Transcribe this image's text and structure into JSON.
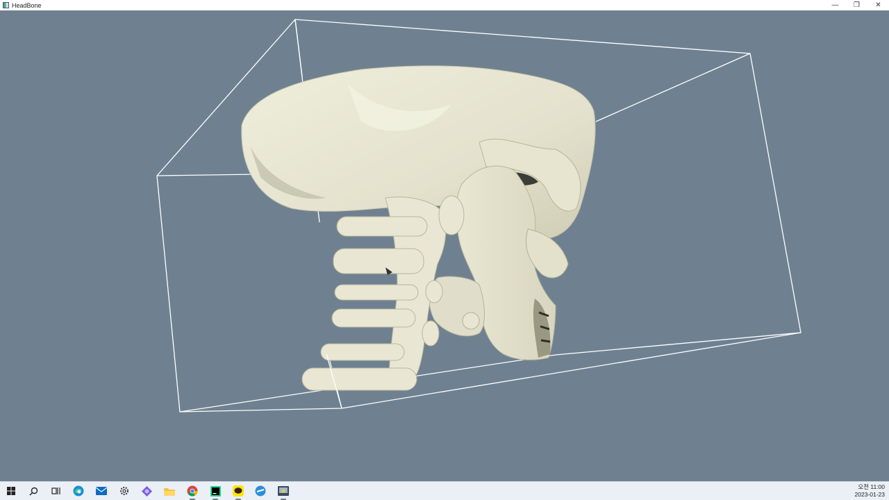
{
  "window": {
    "title": "HeadBone",
    "minimize_glyph": "—",
    "restore_glyph": "❐",
    "close_glyph": "✕"
  },
  "viewport": {
    "background": "#6f8191",
    "model": "skull-and-cervical-spine-bone-surface",
    "bone_color": "#ebe9d6",
    "bounding_box_color": "#ffffff"
  },
  "taskbar": {
    "icons": [
      {
        "name": "windows-start-icon",
        "interactable": true
      },
      {
        "name": "search-icon",
        "interactable": true
      },
      {
        "name": "task-view-icon",
        "interactable": true
      },
      {
        "name": "edge-browser-icon",
        "interactable": true
      },
      {
        "name": "mail-icon",
        "interactable": true
      },
      {
        "name": "settings-gear-icon",
        "interactable": true
      },
      {
        "name": "app-purple-icon",
        "interactable": true
      },
      {
        "name": "file-explorer-icon",
        "interactable": true
      },
      {
        "name": "chrome-icon",
        "interactable": true
      },
      {
        "name": "pycharm-icon",
        "interactable": true
      },
      {
        "name": "kakaotalk-icon",
        "interactable": true
      },
      {
        "name": "app-blue-icon",
        "interactable": true
      },
      {
        "name": "python-app-icon",
        "interactable": true
      }
    ],
    "clock": {
      "time": "오전 11:00",
      "date": "2023-01-23"
    }
  }
}
